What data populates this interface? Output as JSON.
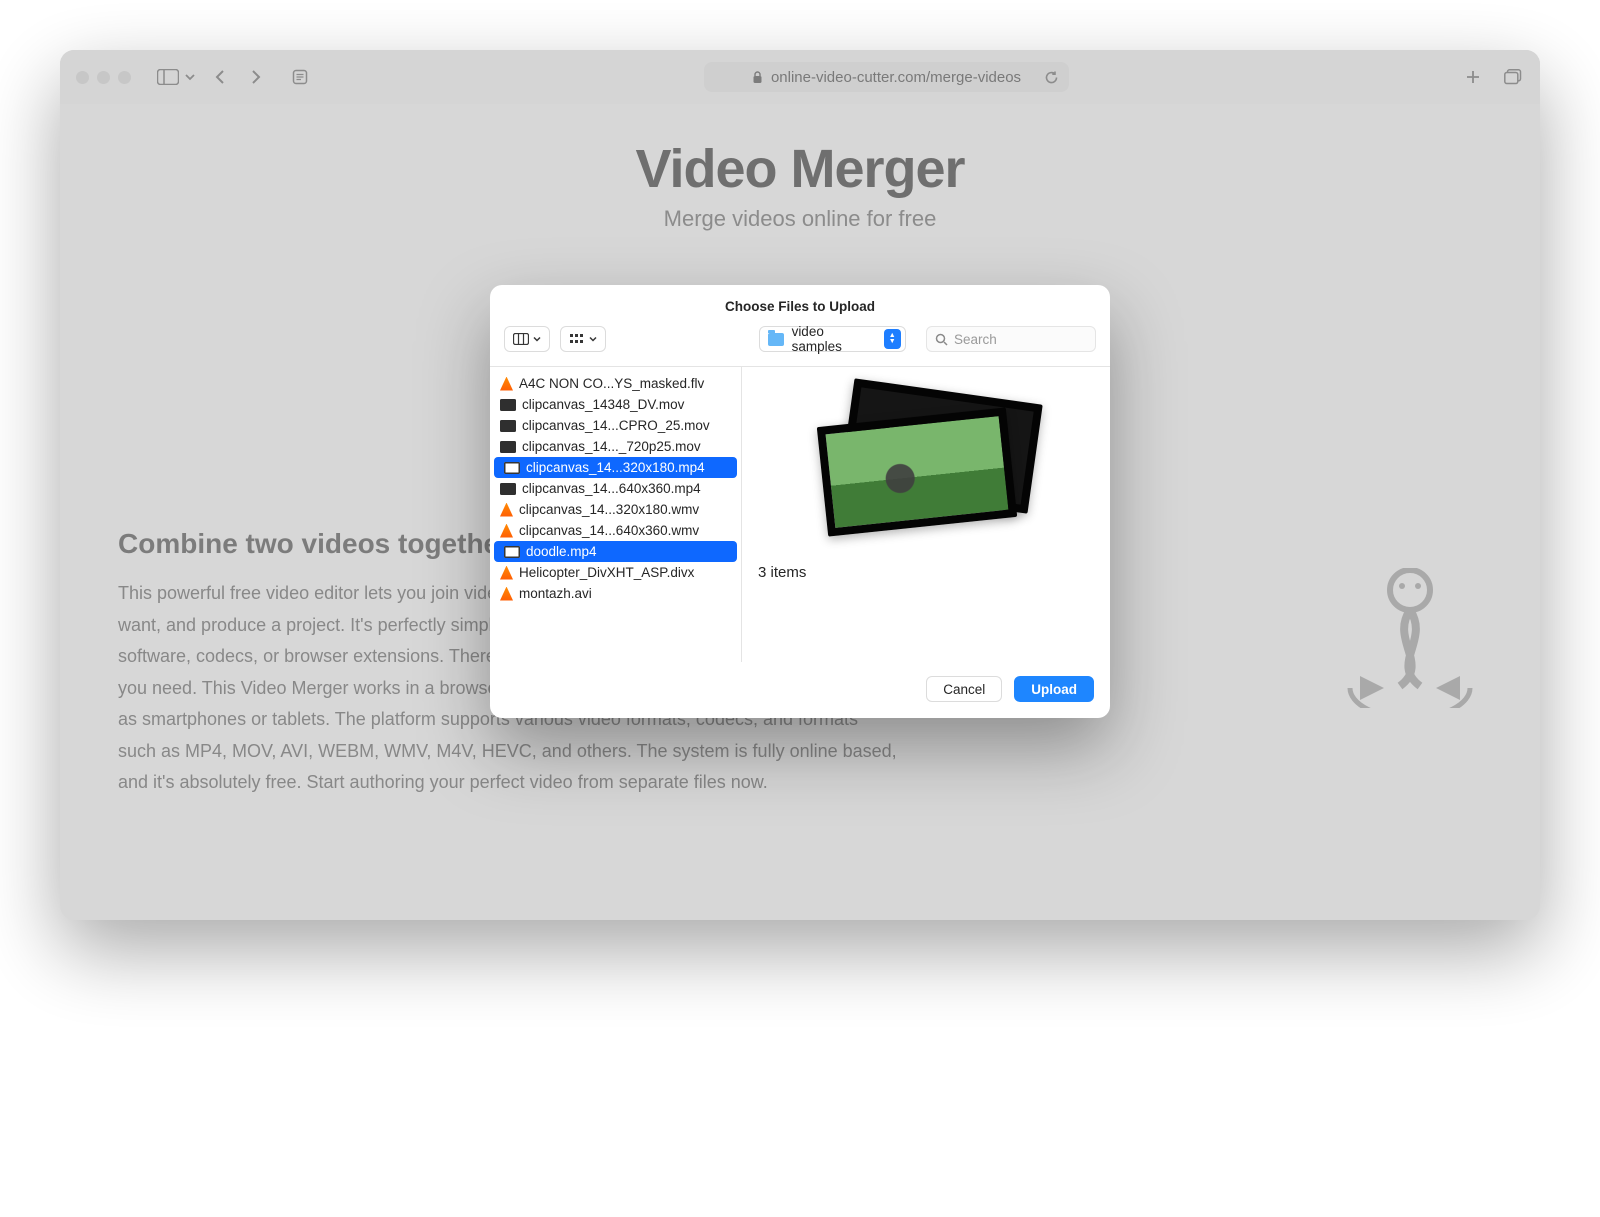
{
  "browser": {
    "url": "online-video-cutter.com/merge-videos"
  },
  "page": {
    "title": "Video Merger",
    "subtitle": "Merge videos online for free",
    "section_heading": "Combine two videos together",
    "section_body": "This powerful free video editor lets you join videos of any type together. Reorder them as you want, and produce a project. It's perfectly simple and straightforward. No need to install heavy software, codecs, or browser extensions. There is no learning curve, and the UI has every tool you need. This Video Merger works in a browser on desktop computers and mobile devices, such as smartphones or tablets. The platform supports various video formats, codecs, and formats such as MP4, MOV, AVI, WEBM, WMV, M4V, HEVC, and others. The system is fully online based, and it's absolutely free. Start authoring your perfect video from separate files now."
  },
  "dialog": {
    "title": "Choose Files to Upload",
    "location": "video samples",
    "search_placeholder": "Search",
    "preview_count": "3 items",
    "cancel_label": "Cancel",
    "upload_label": "Upload",
    "files": [
      {
        "name": "A4C NON CO...YS_masked.flv",
        "icon": "cone",
        "selected": false
      },
      {
        "name": "clipcanvas_14348_DV.mov",
        "icon": "dark",
        "selected": false
      },
      {
        "name": "clipcanvas_14...CPRO_25.mov",
        "icon": "dark",
        "selected": false
      },
      {
        "name": "clipcanvas_14..._720p25.mov",
        "icon": "dark",
        "selected": false
      },
      {
        "name": "clipcanvas_14...320x180.mp4",
        "icon": "inv",
        "selected": true
      },
      {
        "name": "clipcanvas_14...640x360.mp4",
        "icon": "dark",
        "selected": false
      },
      {
        "name": "clipcanvas_14...320x180.wmv",
        "icon": "cone",
        "selected": false
      },
      {
        "name": "clipcanvas_14...640x360.wmv",
        "icon": "cone",
        "selected": false
      },
      {
        "name": "doodle.mp4",
        "icon": "inv",
        "selected": true
      },
      {
        "name": "Helicopter_DivXHT_ASP.divx",
        "icon": "cone",
        "selected": false
      },
      {
        "name": "montazh.avi",
        "icon": "cone",
        "selected": false
      }
    ]
  }
}
